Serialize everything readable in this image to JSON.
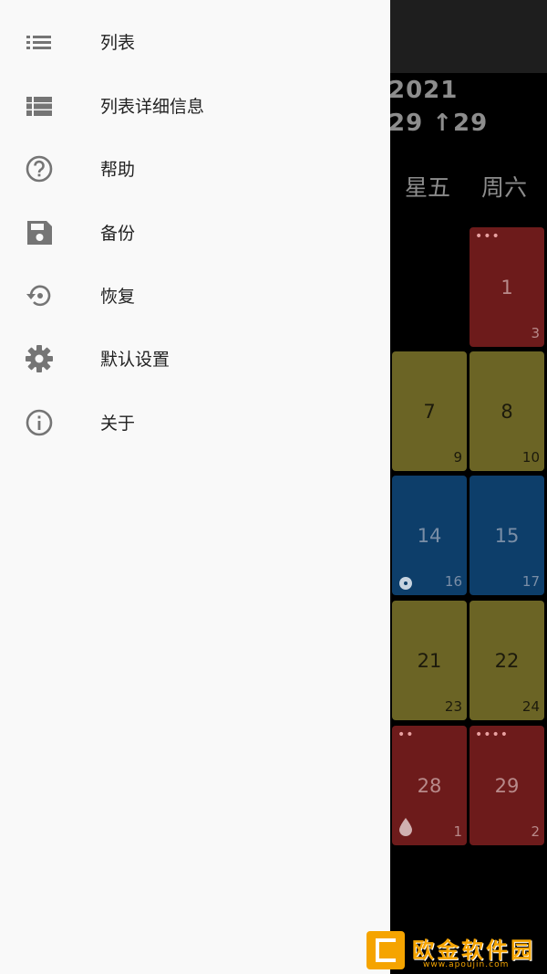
{
  "drawer": {
    "items": [
      {
        "label": "列表",
        "icon": "list-icon"
      },
      {
        "label": "列表详细信息",
        "icon": "list-detail-icon"
      },
      {
        "label": "帮助",
        "icon": "help-icon"
      },
      {
        "label": "备份",
        "icon": "save-icon"
      },
      {
        "label": "恢复",
        "icon": "restore-icon"
      },
      {
        "label": "默认设置",
        "icon": "gear-icon"
      },
      {
        "label": "关于",
        "icon": "info-icon"
      }
    ]
  },
  "calendar": {
    "year": "2021",
    "counter": "29 ↑29",
    "weekdays": [
      "星五",
      "周六"
    ],
    "cells": [
      {
        "day": "1",
        "corner": "3",
        "color": "red",
        "dots": "•••"
      },
      {
        "day": "7",
        "corner": "9",
        "color": "yellow"
      },
      {
        "day": "8",
        "corner": "10",
        "color": "yellow"
      },
      {
        "day": "14",
        "corner": "16",
        "color": "blue",
        "marker": "ring"
      },
      {
        "day": "15",
        "corner": "17",
        "color": "blue"
      },
      {
        "day": "21",
        "corner": "23",
        "color": "yellow"
      },
      {
        "day": "22",
        "corner": "24",
        "color": "yellow"
      },
      {
        "day": "28",
        "corner": "1",
        "color": "red",
        "dots": "••",
        "marker": "drop"
      },
      {
        "day": "29",
        "corner": "2",
        "color": "red",
        "dots": "••••"
      }
    ]
  },
  "watermark": {
    "text": "欧金软件园",
    "url": "www.apoujin.com"
  },
  "colors": {
    "red": "#6d1b1b",
    "yellow": "#6b6425",
    "blue": "#0d3e6a",
    "drawer_bg": "#f9f9f9",
    "icon_gray": "#757575"
  }
}
